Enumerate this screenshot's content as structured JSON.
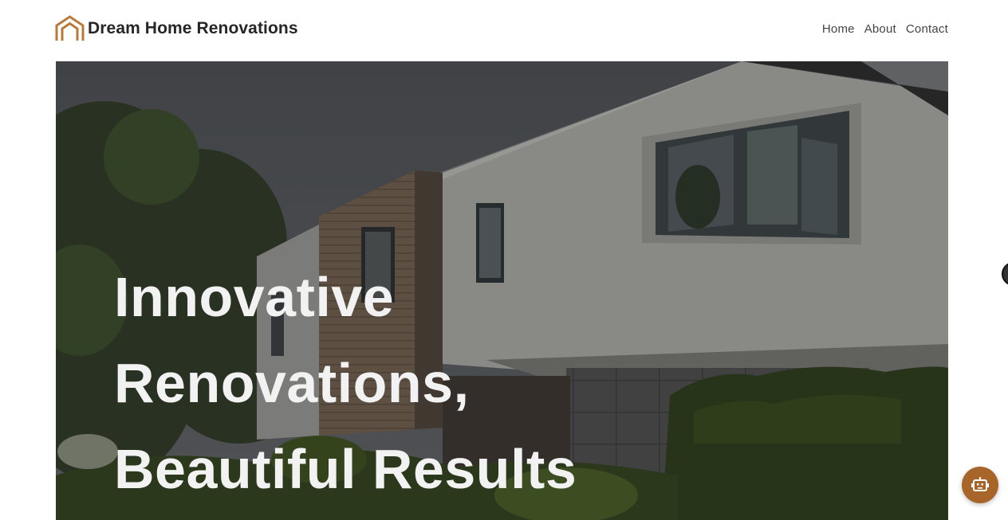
{
  "brand": {
    "name": "Dream Home Renovations",
    "logo_icon": "house-outline-icon",
    "accent": "#b97a39"
  },
  "nav": {
    "items": [
      {
        "label": "Home"
      },
      {
        "label": "About"
      },
      {
        "label": "Contact"
      }
    ]
  },
  "hero": {
    "headline_lines": [
      "Innovative",
      "Renovations,",
      "Beautiful Results"
    ],
    "image": "modern-house-photo"
  },
  "chat": {
    "icon": "robot-icon",
    "color": "#a8652a"
  }
}
